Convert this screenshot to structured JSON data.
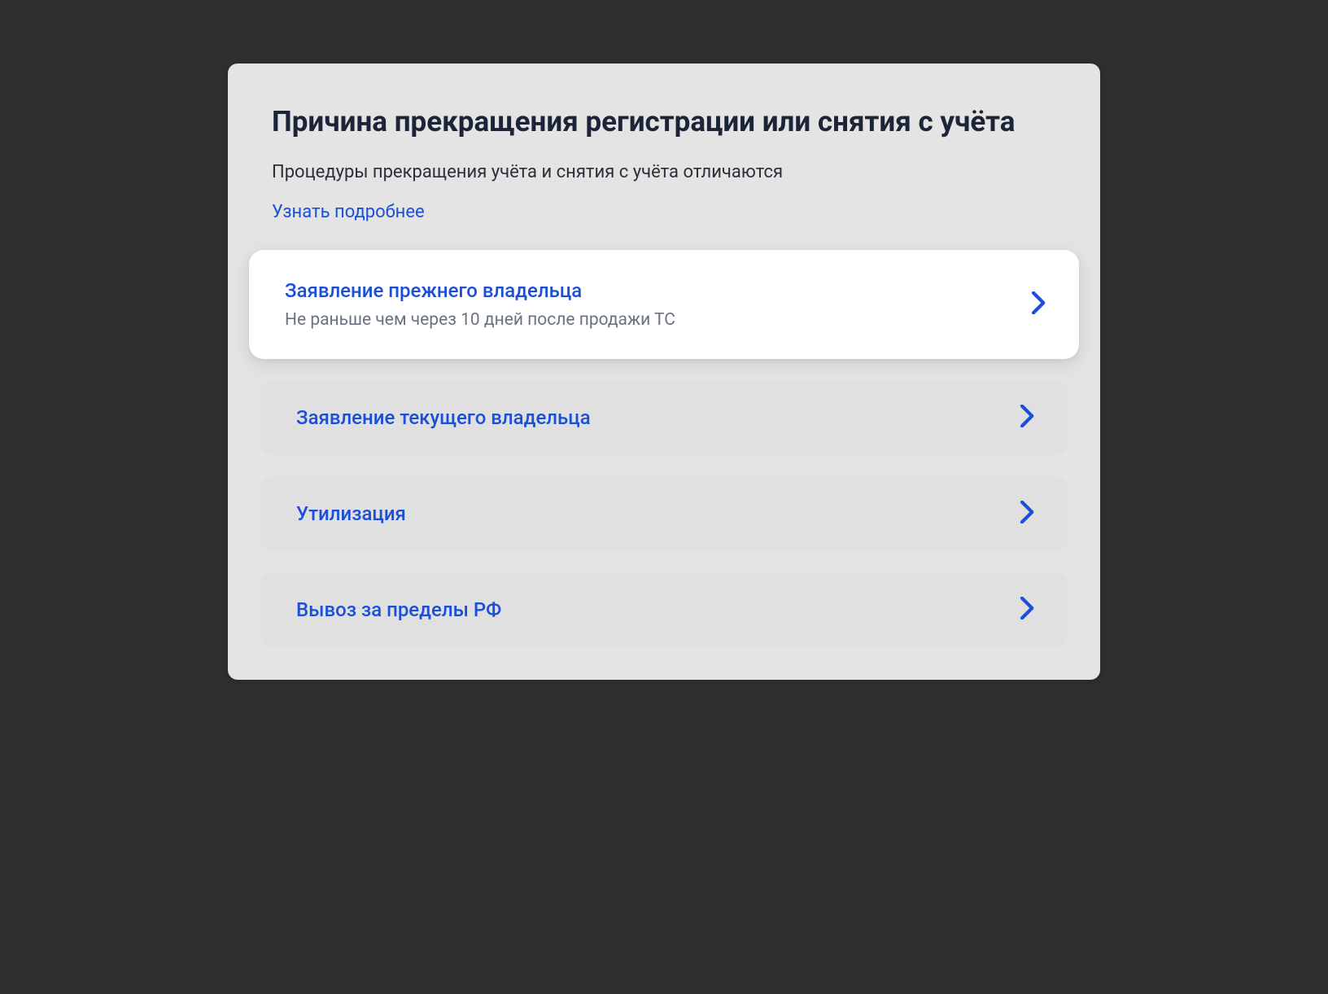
{
  "header": {
    "title": "Причина прекращения регистрации или снятия с учёта",
    "subtitle": "Процедуры прекращения учёта и снятия с учёта отличаются",
    "learn_more": "Узнать подробнее"
  },
  "options": [
    {
      "label": "Заявление прежнего владельца",
      "desc": "Не раньше чем через 10 дней после продажи ТС",
      "highlighted": true
    },
    {
      "label": "Заявление текущего владельца",
      "desc": "",
      "highlighted": false
    },
    {
      "label": "Утилизация",
      "desc": "",
      "highlighted": false
    },
    {
      "label": "Вывоз за пределы РФ",
      "desc": "",
      "highlighted": false
    }
  ]
}
